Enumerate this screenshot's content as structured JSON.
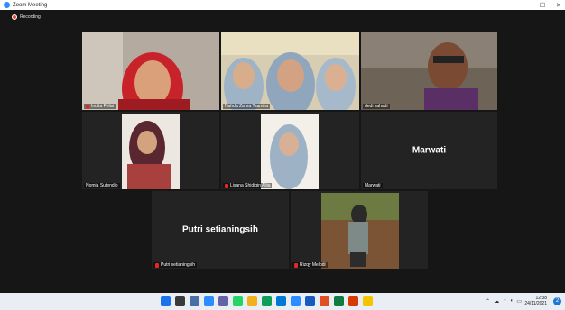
{
  "window": {
    "title": "Zoom Meeting",
    "controls": [
      "–",
      "☐",
      "✕"
    ]
  },
  "recording": {
    "label": "Recording"
  },
  "participants": [
    {
      "name": "Indita Felisi",
      "muted": true
    },
    {
      "name": "Nahda Zahra Tsamira",
      "muted": false
    },
    {
      "name": "dedi sahadi",
      "muted": false
    },
    {
      "name": "Nomia Sutendio",
      "muted": false
    },
    {
      "name": "Lisana Shidiqin Aljia",
      "muted": true
    },
    {
      "name": "Marwati",
      "muted": false,
      "display": "Marwati"
    },
    {
      "name": "Putri setianingsih",
      "muted": true,
      "display": "Putri setianingsih"
    },
    {
      "name": "Rizqy Melodi",
      "muted": true
    }
  ],
  "taskbar": {
    "time": "12:38",
    "date": "24/11/2021",
    "notifications": "2"
  },
  "colors": {
    "active_speaker": "#a6d22a",
    "recording": "#e74c3c",
    "zoom_blue": "#2d8cff"
  }
}
